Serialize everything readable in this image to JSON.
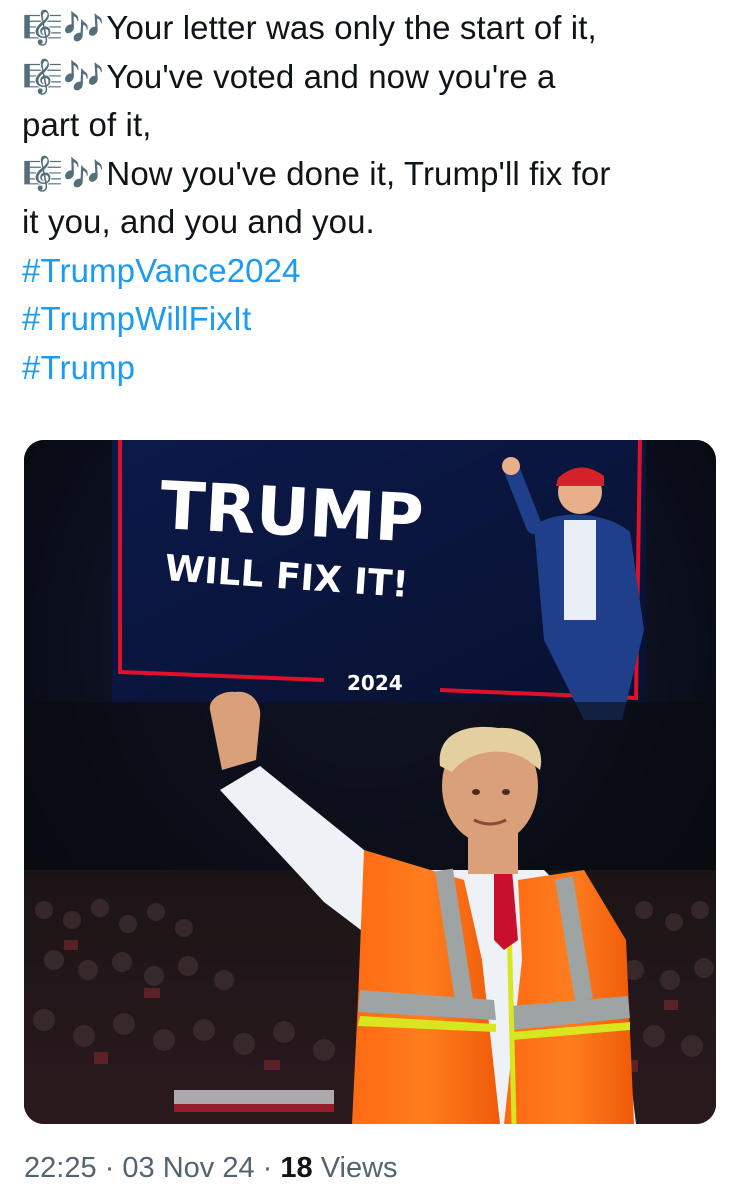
{
  "tweet": {
    "lines": [
      {
        "emoji": "🎼🎶",
        "text": "Your letter was only the start of it,"
      },
      {
        "emoji": "🎼🎶",
        "text": "You've voted and now you're a"
      },
      {
        "emoji": "",
        "text": "part of it,"
      },
      {
        "emoji": "🎼🎶",
        "text": "Now you've done it, Trump'll fix for"
      },
      {
        "emoji": "",
        "text": "it you, and you and you."
      }
    ],
    "hashtags": [
      "#TrumpVance2024",
      "#TrumpWillFixIt",
      "#Trump"
    ]
  },
  "media": {
    "screen_line1": "TRUMP",
    "screen_line2": "WILL FIX IT!",
    "screen_year": "2024"
  },
  "meta": {
    "time": "22:25",
    "separator": "·",
    "date": "03 Nov 24",
    "views_count": "18",
    "views_label": "Views"
  }
}
